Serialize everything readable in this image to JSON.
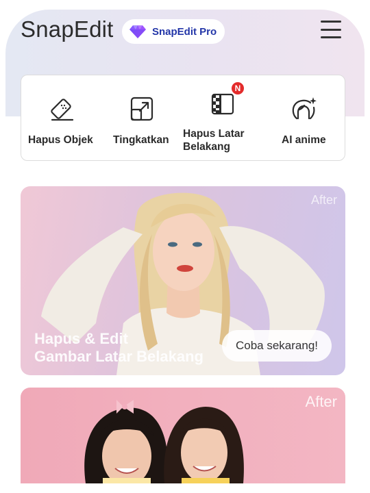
{
  "header": {
    "app_name": "SnapEdit",
    "pro_badge_label": "SnapEdit Pro",
    "menu_icon": "hamburger-menu-icon"
  },
  "tools": [
    {
      "label": "Hapus Objek",
      "icon": "eraser-icon"
    },
    {
      "label": "Tingkatkan",
      "icon": "upscale-icon"
    },
    {
      "label_line1": "Hapus Latar",
      "label_line2": "Belakang",
      "icon": "remove-background-icon",
      "badge": "N"
    },
    {
      "label": "AI anime",
      "icon": "ai-anime-icon"
    }
  ],
  "banners": [
    {
      "after_label": "After",
      "title_line1": "Hapus & Edit",
      "title_line2": "Gambar Latar Belakang",
      "cta_label": "Coba sekarang!"
    },
    {
      "after_label": "After"
    }
  ],
  "colors": {
    "brand_text": "#2336a8",
    "badge_red": "#e32b2b",
    "banner1_gradient": "#f0c8d6",
    "banner2_gradient": "#f0a9b8"
  }
}
